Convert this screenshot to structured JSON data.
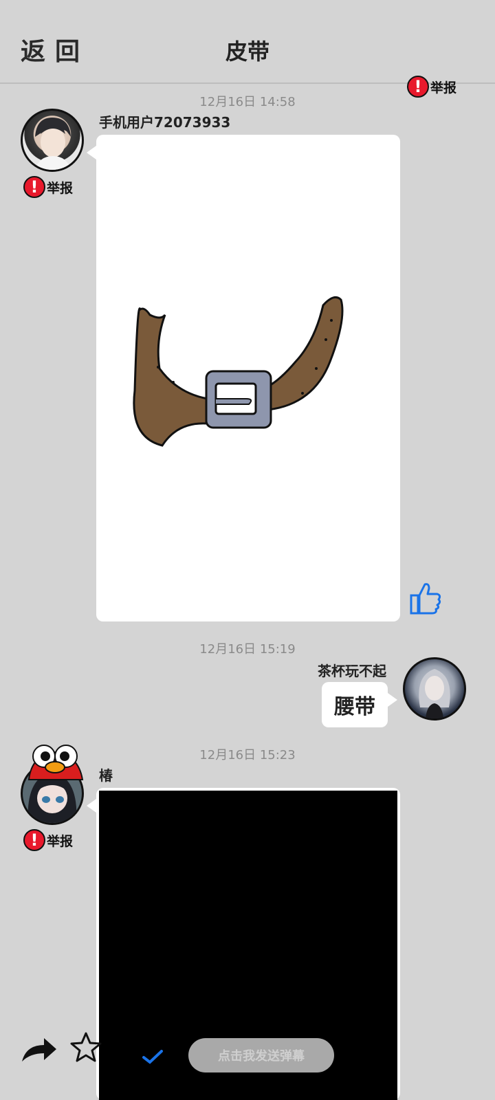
{
  "header": {
    "back_label": "返回",
    "title": "皮带"
  },
  "report_label": "举报",
  "messages": [
    {
      "time": "12月16日 14:58",
      "user": "手机用户72073933"
    },
    {
      "time": "12月16日 15:19",
      "user": "茶杯玩不起",
      "text": "腰带"
    },
    {
      "time": "12月16日 15:23",
      "user": "椿"
    }
  ],
  "bottom": {
    "danmu_placeholder": "点击我发送弹幕"
  },
  "icons": {
    "forward": "share-arrow-icon",
    "favorite": "star-icon",
    "check": "check-icon",
    "like": "thumbs-up-icon"
  },
  "colors": {
    "report_red": "#e8192c",
    "like_blue": "#1a73e8",
    "background": "#d4d4d4"
  }
}
